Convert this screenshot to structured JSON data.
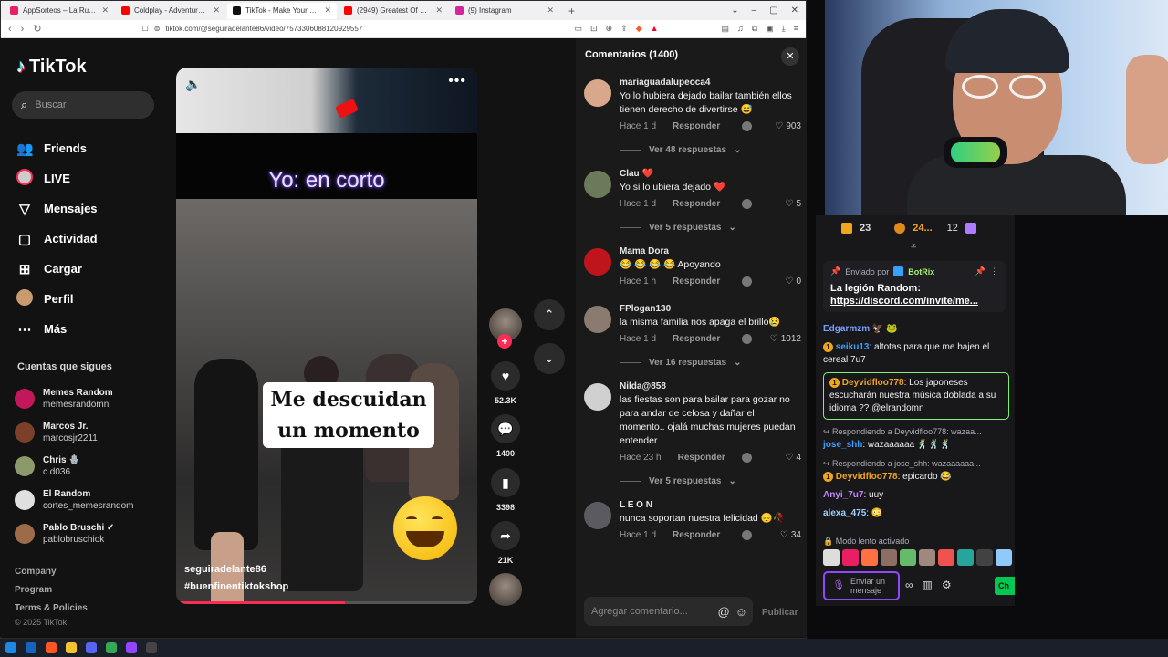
{
  "browser": {
    "tabs": [
      {
        "title": "AppSorteos – La Ruleta de la Suerte",
        "color": "#e91e63",
        "active": false
      },
      {
        "title": "Coldplay - Adventure Of A Lifetime",
        "color": "#ff0000",
        "active": false
      },
      {
        "title": "TikTok - Make Your Day",
        "color": "#111111",
        "active": true
      },
      {
        "title": "(2949) Greatest Of Michael Jackson",
        "color": "#ff0000",
        "active": false
      },
      {
        "title": "(9) Instagram",
        "color": "#d6249f",
        "active": false
      }
    ],
    "new_tab": "+",
    "url": "tiktok.com/@seguiradelante86/video/7573306088120929557"
  },
  "tiktok": {
    "logo": "TikTok",
    "search_placeholder": "Buscar",
    "menu": [
      {
        "label": "Friends",
        "icon": "friends-icon",
        "glyph": "👥"
      },
      {
        "label": "LIVE",
        "icon": "live-icon",
        "glyph": "●"
      },
      {
        "label": "Mensajes",
        "icon": "messages-icon",
        "glyph": "▽"
      },
      {
        "label": "Actividad",
        "icon": "activity-icon",
        "glyph": "▢"
      },
      {
        "label": "Cargar",
        "icon": "upload-icon",
        "glyph": "⊞"
      },
      {
        "label": "Perfil",
        "icon": "profile-icon",
        "glyph": "●"
      },
      {
        "label": "Más",
        "icon": "more-icon",
        "glyph": "⋯"
      }
    ],
    "following_header": "Cuentas que sigues",
    "following": [
      {
        "name": "Memes Random",
        "user": "memesrandomn",
        "color": "#c2185b"
      },
      {
        "name": "Marcos Jr.",
        "user": "marcosjr2211",
        "color": "#7b3f2a"
      },
      {
        "name": "Chris 🪬",
        "user": "c.d036",
        "color": "#8a9a6a"
      },
      {
        "name": "El Random",
        "user": "cortes_memesrandom",
        "color": "#e0e0e0"
      },
      {
        "name": "Pablo Bruschi ✓",
        "user": "pablobruschiok",
        "color": "#9e6b4a"
      }
    ],
    "footer": [
      "Company",
      "Program",
      "Terms & Policies"
    ],
    "copyright": "© 2025 TikTok"
  },
  "video": {
    "caption_top": "Yo: en corto",
    "caption_box": "Me descuidan un momento",
    "author": "seguiradelante86",
    "hashtag": "#buenfinentiktokshop",
    "progress": 0.56,
    "likes": "52.3K",
    "comments": "1400",
    "saves": "3398",
    "shares": "21K"
  },
  "comments": {
    "title": "Comentarios (1400)",
    "reply_label": "Responder",
    "items": [
      {
        "user": "mariaguadalupeoca4",
        "text": "Yo lo hubiera dejado bailar también ellos tienen derecho de divertirse 😅",
        "time": "Hace 1 d",
        "likes": "903",
        "more": "Ver 48 respuestas",
        "color": "#d9a88c"
      },
      {
        "user": "Clau ❤️",
        "text": "Yo si lo ubiera dejado ❤️",
        "time": "Hace 1 d",
        "likes": "5",
        "more": "Ver 5 respuestas",
        "color": "#6b7a5a"
      },
      {
        "user": "Mama Dora",
        "text": "😂 😂 😂 😂  Apoyando",
        "time": "Hace 1 h",
        "likes": "0",
        "more": "",
        "color": "#c0141c"
      },
      {
        "user": "FPlogan130",
        "text": "la misma familia nos apaga el brillo😢",
        "time": "Hace 1 d",
        "likes": "1012",
        "more": "Ver 16 respuestas",
        "color": "#8a7a70"
      },
      {
        "user": "Nilda@858",
        "text": "las fiestas son para bailar para gozar no para andar de celosa y dañar el momento.. ojalá muchas mujeres puedan entender",
        "time": "Hace 23 h",
        "likes": "4",
        "more": "Ver 5 respuestas",
        "color": "#d0d0d0"
      },
      {
        "user": "L E O N",
        "text": "nunca soportan nuestra felicidad 😔🥀",
        "time": "Hace 1 d",
        "likes": "34",
        "more": "",
        "color": "#5a5a60"
      }
    ],
    "input_placeholder": "Agregar comentario...",
    "post_label": "Publicar"
  },
  "chat": {
    "top": {
      "gift1": "23",
      "gift2": "24...",
      "gift3": "12"
    },
    "pinned_by_label": "Enviado por",
    "pinned_by": "BotRix",
    "pinned_text": "La legión Random:",
    "pinned_link": "https://discord.com/invite/me...",
    "messages": [
      {
        "type": "msg",
        "user": "Edgarmzm",
        "text": " 🦅 🐸",
        "color": "#7aa0ff"
      },
      {
        "type": "msg",
        "user": "seiku13",
        "text": ": altotas para que me bajen el cereal 7u7",
        "color": "#3aa0ff",
        "badge": "1"
      },
      {
        "type": "hl",
        "user": "Deyvidfloo778",
        "text": ": Los japoneses escucharán nuestra música doblada a su idioma ?? @elrandomn",
        "color": "#f0a51e",
        "badge": "1"
      },
      {
        "type": "reply",
        "text": "Respondiendo a Deyvidfloo778: wazaa..."
      },
      {
        "type": "msg",
        "user": "jose_shh",
        "text": ": wazaaaaaa 🕺🕺🕺",
        "color": "#3aa0ff"
      },
      {
        "type": "reply",
        "text": "Respondiendo a jose_shh: wazaaaaaa..."
      },
      {
        "type": "msg",
        "user": "Deyvidfloo778",
        "text": ": epicardo 😂",
        "color": "#f0a51e",
        "badge": "1"
      },
      {
        "type": "msg",
        "user": "Anyi_7u7",
        "text": ": uuy",
        "color": "#c08aff"
      },
      {
        "type": "msg",
        "user": "alexa_475",
        "text": ": 😳",
        "color": "#9fd0ff"
      }
    ],
    "slow_mode": "Modo lento activado",
    "input_placeholder": "Enviar un mensaje",
    "chat_button": "Ch"
  }
}
